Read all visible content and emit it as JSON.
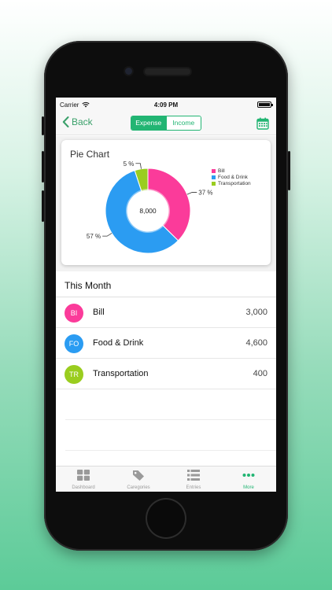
{
  "status_bar": {
    "carrier": "Carrier",
    "time": "4:09 PM"
  },
  "navbar": {
    "back_label": "Back",
    "segments": [
      {
        "label": "Expense",
        "selected": true
      },
      {
        "label": "Income",
        "selected": false
      }
    ],
    "calendar_icon": "calendar-icon"
  },
  "chart_card": {
    "title": "Pie Chart",
    "center_label": "8,000"
  },
  "chart_data": {
    "type": "pie",
    "title": "Pie Chart",
    "categories": [
      "Bill",
      "Food & Drink",
      "Transportation"
    ],
    "values": [
      37,
      57,
      5
    ],
    "value_labels": [
      "37 %",
      "57 %",
      "5 %"
    ],
    "colors": [
      "#fb3b9a",
      "#2b9cf2",
      "#9acd1f"
    ],
    "legend_position": "top-right",
    "hole": true,
    "center_text": "8,000"
  },
  "section": {
    "title": "This Month"
  },
  "entries": [
    {
      "initials": "BI",
      "name": "Bill",
      "amount": "3,000",
      "color": "#fb3b9a"
    },
    {
      "initials": "FO",
      "name": "Food & Drink",
      "amount": "4,600",
      "color": "#2b9cf2"
    },
    {
      "initials": "TR",
      "name": "Transportation",
      "amount": "400",
      "color": "#9acd1f"
    }
  ],
  "tabbar": [
    {
      "label": "Dashboard",
      "icon": "grid-icon",
      "active": false
    },
    {
      "label": "Caregories",
      "icon": "tag-icon",
      "active": false
    },
    {
      "label": "Entries",
      "icon": "list-icon",
      "active": false
    },
    {
      "label": "More",
      "icon": "more-dots-icon",
      "active": true
    }
  ],
  "colors": {
    "accent": "#22b573",
    "accent_text": "#3aa06a"
  }
}
